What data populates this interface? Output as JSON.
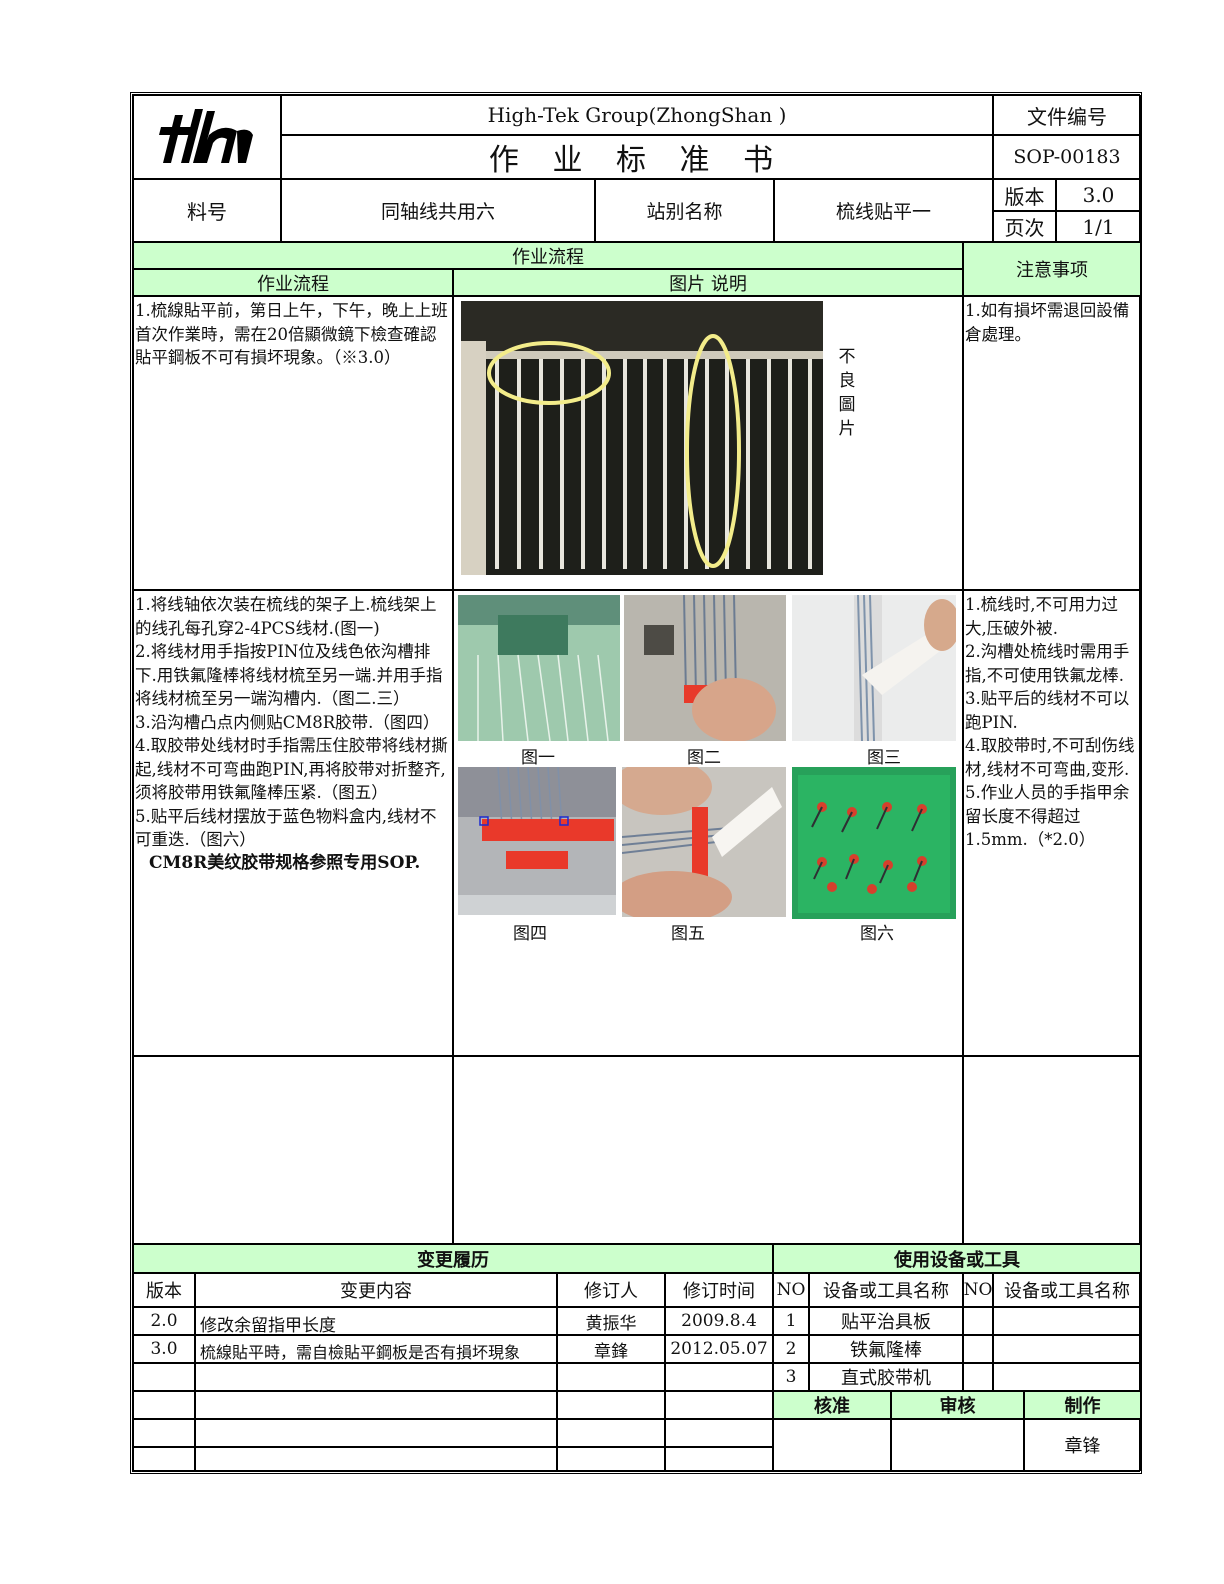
{
  "header": {
    "company": "High-Tek Group(ZhongShan )",
    "title": "作 业 标 准 书",
    "doc_no_label": "文件编号",
    "doc_no": "SOP-00183",
    "part_label": "料号",
    "part_value": "同轴线共用六",
    "station_label": "站别名称",
    "station_value": "梳线贴平一",
    "version_label": "版本",
    "version_value": "3.0",
    "page_label": "页次",
    "page_value": "1/1"
  },
  "section": {
    "flow_title": "作业流程",
    "flow_col": "作业流程",
    "pic_col": "图片 说明",
    "notes_col": "注意事项"
  },
  "row1": {
    "steps": "1.梳線貼平前，第日上午，下午，晚上上班首次作業時，需在20倍顯微鏡下檢查確認貼平鋼板不可有損坏現象。（※3.0）",
    "bad_label": [
      "不",
      "良",
      "圖",
      "片"
    ],
    "notes": "1.如有損坏需退回設備倉處理。"
  },
  "row2": {
    "steps": [
      "1.将线轴依次装在梳线的架子上.梳线架上的线孔每孔穿2-4PCS线材.(图一)",
      "2.将线材用手指按PIN位及线色依沟槽排下.用铁氟隆棒将线材梳至另一端.并用手指将线材梳至另一端沟槽内.（图二.三）",
      "3.沿沟槽凸点内侧贴CM8R胶带.（图四）",
      "4.取胶带处线材时手指需压住胶带将线材撕起,线材不可弯曲跑PIN,再将胶带对折整齐,须将胶带用铁氟隆棒压紧.（图五）",
      "5.贴平后线材摆放于蓝色物料盒内,线材不可重迭.（图六）"
    ],
    "steps_bold": "CM8R美纹胶带规格参照专用SOP.",
    "captions": [
      "图一",
      "图二",
      "图三",
      "图四",
      "图五",
      "图六"
    ],
    "notes": [
      "1.梳线时,不可用力过大,压破外被.",
      "2.沟槽处梳线时需用手指,不可使用铁氟龙棒.",
      "3.贴平后的线材不可以跑PIN.",
      "4.取胶带时,不可刮伤线材,线材不可弯曲,变形.",
      "5.作业人员的手指甲余留长度不得超过1.5mm.（*2.0）"
    ]
  },
  "history": {
    "title": "变更履历",
    "headers": [
      "版本",
      "变更内容",
      "修订人",
      "修订时间"
    ],
    "rows": [
      [
        "2.0",
        "修改余留指甲长度",
        "黄振华",
        "2009.8.4"
      ],
      [
        "3.0",
        "梳線貼平時，需自檢貼平鋼板是否有損坏現象",
        "章鋒",
        "2012.05.07"
      ]
    ]
  },
  "equipment": {
    "title": "使用设备或工具",
    "headers": [
      "NO",
      "设备或工具名称",
      "NO",
      "设备或工具名称"
    ],
    "rows": [
      [
        "1",
        "贴平治具板"
      ],
      [
        "2",
        "铁氟隆棒"
      ],
      [
        "3",
        "直式胶带机"
      ]
    ]
  },
  "approval": {
    "labels": [
      "核准",
      "审核",
      "制作"
    ],
    "maker": "章锋"
  },
  "colors": {
    "header_green": "#ccffcc",
    "highlight_yellow": "#f3ec8a"
  },
  "icons": [
    "company-logo"
  ]
}
